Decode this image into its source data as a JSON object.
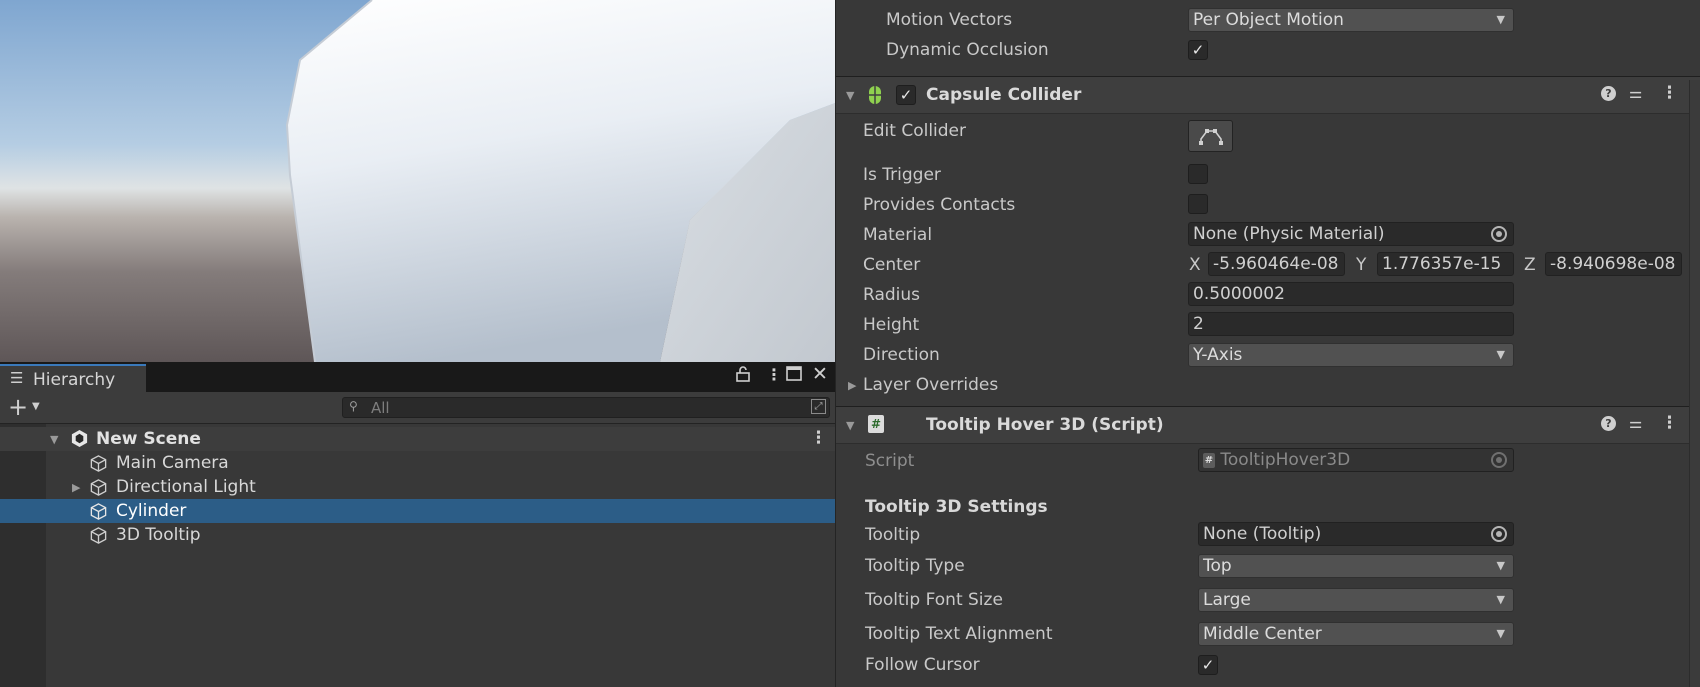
{
  "hierarchy": {
    "tab_title": "Hierarchy",
    "search_placeholder": "All",
    "scene_name": "New Scene",
    "items": [
      {
        "label": "Main Camera",
        "selected": false,
        "expandable": false
      },
      {
        "label": "Directional Light",
        "selected": false,
        "expandable": true
      },
      {
        "label": "Cylinder",
        "selected": true,
        "expandable": false
      },
      {
        "label": "3D Tooltip",
        "selected": false,
        "expandable": false
      }
    ]
  },
  "inspector": {
    "top_fields": {
      "motion_vectors_label": "Motion Vectors",
      "motion_vectors_value": "Per Object Motion",
      "dynamic_occlusion_label": "Dynamic Occlusion",
      "dynamic_occlusion_checked": true
    },
    "capsule_collider": {
      "title": "Capsule Collider",
      "enabled": true,
      "edit_collider_label": "Edit Collider",
      "is_trigger_label": "Is Trigger",
      "provides_contacts_label": "Provides Contacts",
      "material_label": "Material",
      "material_value": "None (Physic Material)",
      "center_label": "Center",
      "center_x_label": "X",
      "center_x": "-5.960464e-08",
      "center_y_label": "Y",
      "center_y": "1.776357e-15",
      "center_z_label": "Z",
      "center_z": "-8.940698e-08",
      "radius_label": "Radius",
      "radius_value": "0.5000002",
      "height_label": "Height",
      "height_value": "2",
      "direction_label": "Direction",
      "direction_value": "Y-Axis",
      "layer_overrides_label": "Layer Overrides"
    },
    "tooltip_script": {
      "title": "Tooltip Hover 3D (Script)",
      "script_label": "Script",
      "script_value": "TooltipHover3D",
      "section_title": "Tooltip 3D Settings",
      "tooltip_label": "Tooltip",
      "tooltip_value": "None (Tooltip)",
      "tooltip_type_label": "Tooltip Type",
      "tooltip_type_value": "Top",
      "font_size_label": "Tooltip Font Size",
      "font_size_value": "Large",
      "text_alignment_label": "Tooltip Text Alignment",
      "text_alignment_value": "Middle Center",
      "follow_cursor_label": "Follow Cursor",
      "follow_cursor_checked": true
    }
  },
  "colors": {
    "selection": "#2c5d87",
    "tab_accent": "#3a79bb",
    "collider_icon": "#8fd14f"
  }
}
